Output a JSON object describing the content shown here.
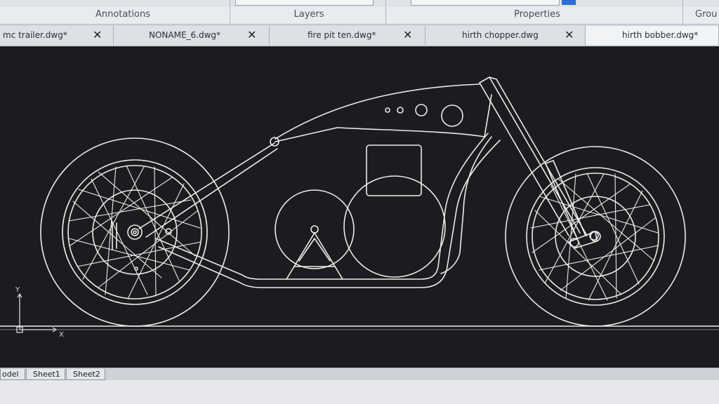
{
  "ribbon": {
    "panels": [
      {
        "label": "Annotations"
      },
      {
        "label": "Layers"
      },
      {
        "label": "Properties"
      },
      {
        "label": "Grou"
      }
    ]
  },
  "tabs": [
    {
      "label": "mc trailer.dwg*",
      "close": "✕"
    },
    {
      "label": "NONAME_6.dwg*",
      "close": "✕"
    },
    {
      "label": "fire pit ten.dwg*",
      "close": "✕"
    },
    {
      "label": "hirth chopper.dwg",
      "close": "✕"
    },
    {
      "label": "hirth bobber.dwg*"
    }
  ],
  "ucs": {
    "x_label": "X",
    "y_label": "Y"
  },
  "layout_tabs": [
    {
      "label": "odel"
    },
    {
      "label": "Sheet1"
    },
    {
      "label": "Sheet2"
    }
  ],
  "colors": {
    "canvas": "#1b1c1f",
    "line": "#ecebe6"
  }
}
